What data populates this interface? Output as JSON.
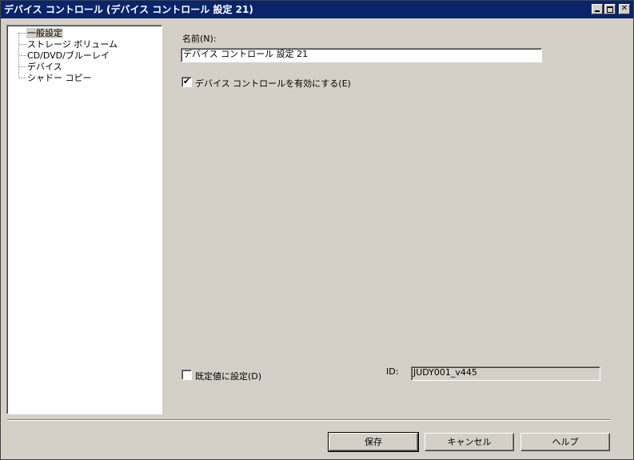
{
  "window": {
    "title": "デバイス コントロール (デバイス コントロール 設定 21)"
  },
  "tree": {
    "items": [
      {
        "label": "一般設定",
        "selected": true
      },
      {
        "label": "ストレージ ボリューム"
      },
      {
        "label": "CD/DVD/ブルーレイ"
      },
      {
        "label": "デバイス"
      },
      {
        "label": "シャドー コピー"
      }
    ]
  },
  "form": {
    "name_label": "名前(N):",
    "name_value": "デバイス コントロール 設定 21",
    "enable_label": "デバイス コントロールを有効にする(E)",
    "enable_checked": "✔",
    "default_label": "既定値に設定(D)",
    "default_checked": "",
    "id_label": "ID:",
    "id_value": "JUDY001_v445"
  },
  "buttons": {
    "save": "保存",
    "cancel": "キャンセル",
    "help": "ヘルプ"
  }
}
